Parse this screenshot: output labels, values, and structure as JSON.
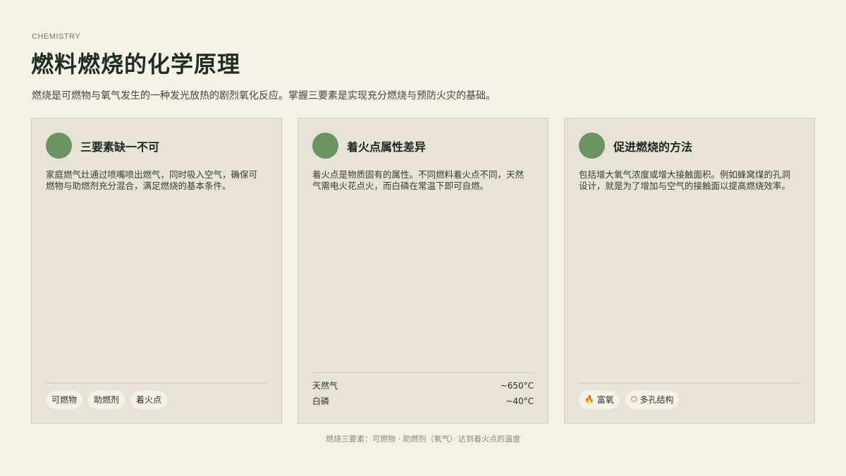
{
  "header": {
    "eyebrow": "CHEMISTRY",
    "title": "燃料燃烧的化学原理",
    "subtitle": "燃烧是可燃物与氧气发生的一种发光放热的剧烈氧化反应。掌握三要素是实现充分燃烧与预防火灾的基础。"
  },
  "cards": [
    {
      "title": "三要素缺一不可",
      "body": "家庭燃气灶通过喷嘴喷出燃气，同时吸入空气，确保可燃物与助燃剂充分混合，满足燃烧的基本条件。",
      "tags": [
        "可燃物",
        "助燃剂",
        "着火点"
      ]
    },
    {
      "title": "着火点属性差异",
      "body": "着火点是物质固有的属性。不同燃料着火点不同，天然气需电火花点火，而白磷在常温下即可自燃。",
      "rows": [
        {
          "label": "天然气",
          "value": "~650°C"
        },
        {
          "label": "白磷",
          "value": "~40°C"
        }
      ]
    },
    {
      "title": "促进燃烧的方法",
      "body": "包括增大氧气浓度或增大接触面积。例如蜂窝煤的孔洞设计，就是为了增加与空气的接触面以提高燃烧效率。",
      "tags": [
        {
          "icon": "flame-icon",
          "label": "富氧"
        },
        {
          "icon": "hexagon-icon",
          "label": "多孔结构"
        }
      ]
    }
  ],
  "footer": "燃烧三要素：可燃物 · 助燃剂（氧气）· 达到着火点的温度",
  "colors": {
    "background": "#f4f1e9",
    "card": "#e8e3d7",
    "accent": "#6c9462"
  }
}
